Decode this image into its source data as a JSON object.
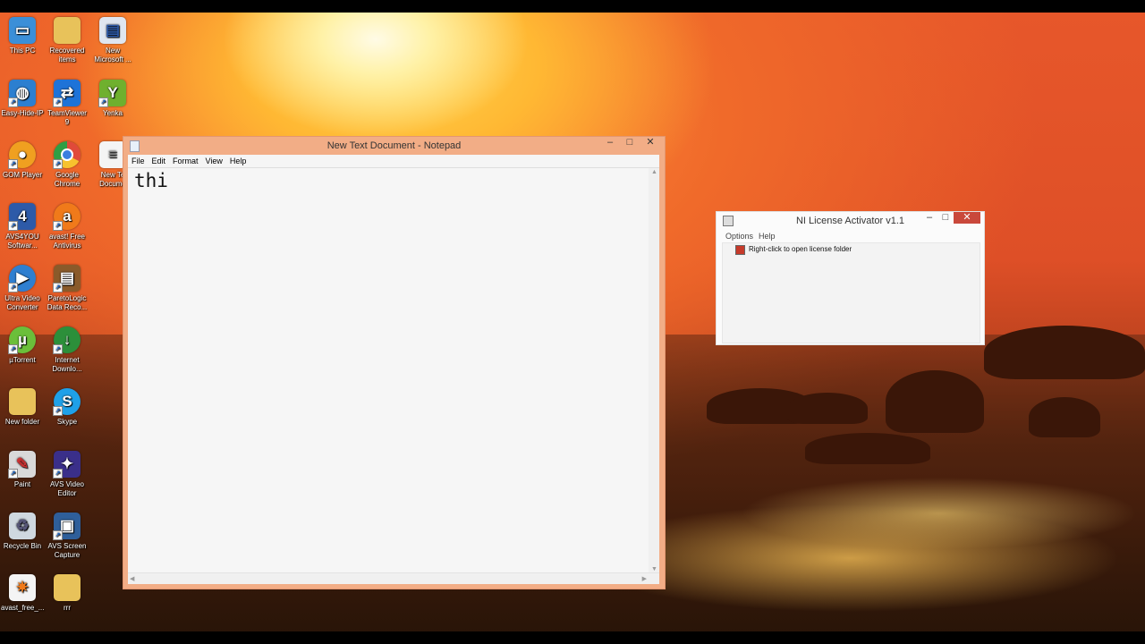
{
  "desktop": {
    "icons": [
      {
        "label": "This PC",
        "icon": "computer-icon",
        "color": "#3b8fd8"
      },
      {
        "label": "Recovered items",
        "icon": "folder-icon",
        "color": "#e8c25a"
      },
      {
        "label": "New Microsoft ...",
        "icon": "document-icon",
        "color": "#dfe6f0"
      },
      {
        "label": "Easy-Hide-IP",
        "icon": "globe-icon",
        "color": "#2c7fd0"
      },
      {
        "label": "TeamViewer 9",
        "icon": "teamviewer-icon",
        "color": "#1e73d8"
      },
      {
        "label": "Yenka",
        "icon": "yenka-icon",
        "color": "#6fb02e"
      },
      {
        "label": "GOM Player",
        "icon": "gom-player-icon",
        "color": "#f0a020"
      },
      {
        "label": "Google Chrome",
        "icon": "chrome-icon",
        "color": "#e04a3a"
      },
      {
        "label": "New Te Docume",
        "icon": "text-document-icon",
        "color": "#f4f4f4"
      },
      {
        "label": "AVS4YOU Softwar...",
        "icon": "avs4you-icon",
        "color": "#2d5aa8"
      },
      {
        "label": "avast! Free Antivirus",
        "icon": "avast-icon",
        "color": "#f07a1a"
      },
      {
        "label": "Ultra Video Converter",
        "icon": "video-converter-icon",
        "color": "#2f7fd0"
      },
      {
        "label": "ParetoLogic Data Reco...",
        "icon": "paretologic-icon",
        "color": "#8a5a2a"
      },
      {
        "label": "µTorrent",
        "icon": "utorrent-icon",
        "color": "#6bbf3a"
      },
      {
        "label": "Internet Downlo...",
        "icon": "internet-download-icon",
        "color": "#2c8f3a"
      },
      {
        "label": "New folder",
        "icon": "folder-icon",
        "color": "#e8c25a"
      },
      {
        "label": "Skype",
        "icon": "skype-icon",
        "color": "#1fa0e8"
      },
      {
        "label": "Paint",
        "icon": "paint-icon",
        "color": "#d9d9d9"
      },
      {
        "label": "AVS Video Editor",
        "icon": "avs-video-editor-icon",
        "color": "#3a2f8a"
      },
      {
        "label": "Recycle Bin",
        "icon": "recycle-bin-icon",
        "color": "#cfd8e0"
      },
      {
        "label": "AVS Screen Capture",
        "icon": "screen-capture-icon",
        "color": "#2f5f9a"
      },
      {
        "label": "avast_free_...",
        "icon": "avast-installer-icon",
        "color": "#f4f4f4"
      },
      {
        "label": "rrr",
        "icon": "folder-icon",
        "color": "#e8c25a"
      }
    ]
  },
  "notepad": {
    "title": "New Text Document - Notepad",
    "controls": {
      "minimize": "–",
      "maximize": "□",
      "close": "✕"
    },
    "menu": [
      "File",
      "Edit",
      "Format",
      "View",
      "Help"
    ],
    "content": "thi"
  },
  "nila": {
    "title": "NI License Activator v1.1",
    "controls": {
      "minimize": "–",
      "maximize": "□",
      "close": "✕"
    },
    "menu": [
      "Options",
      "Help"
    ],
    "tree_item": "Right-click to open license folder"
  },
  "colors": {
    "notepad_frame": "#f2ad86",
    "close_button": "#c9483b"
  }
}
